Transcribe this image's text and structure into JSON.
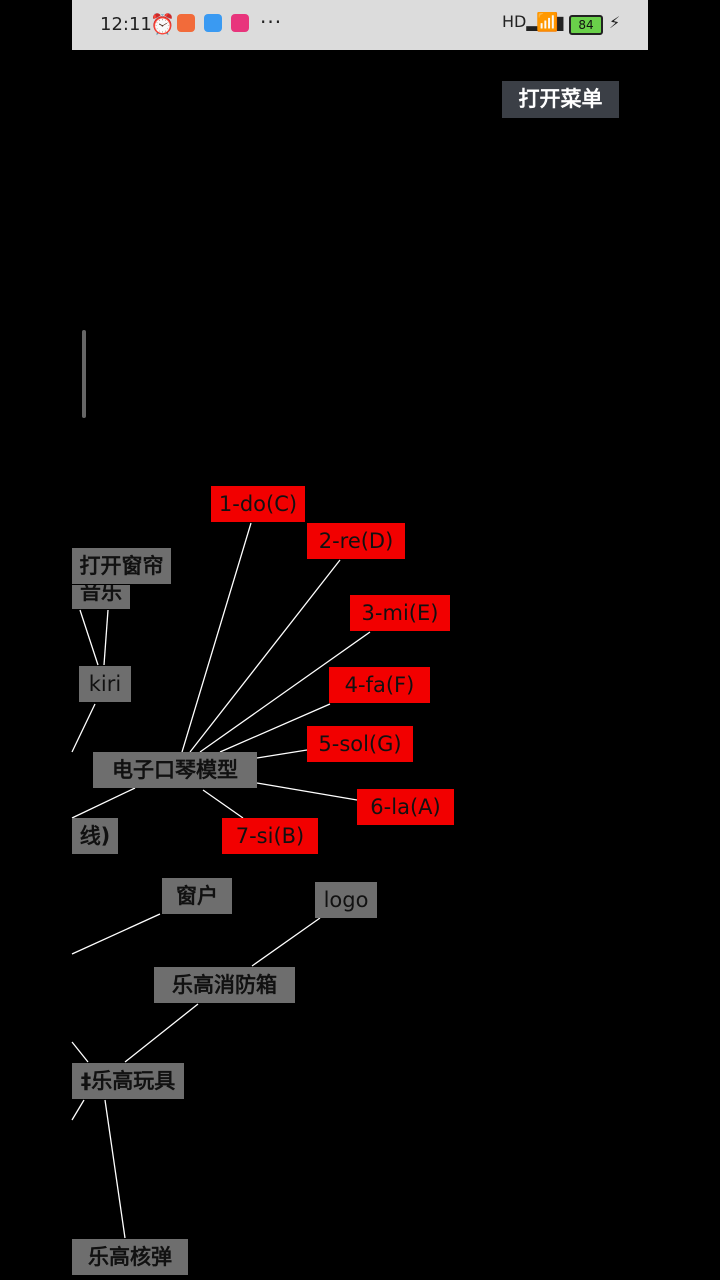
{
  "status_bar": {
    "time": "12:11",
    "battery": "84",
    "network": "HD",
    "app_icons": [
      "app-icon-1",
      "app-icon-2",
      "app-icon-3"
    ],
    "colors": {
      "icon1": "#f26b3a",
      "icon2": "#3a9af2",
      "icon3": "#e8357c"
    }
  },
  "header": {
    "menu_button": "打开菜单"
  },
  "graph": {
    "nodes": {
      "curtain": "打开窗帘",
      "music": "音乐",
      "kiri": "kiri",
      "line": "线)",
      "keyboard": "电子口琴模型",
      "do": "1-do(C)",
      "re": "2-re(D)",
      "mi": "3-mi(E)",
      "fa": "4-fa(F)",
      "sol": "5-sol(G)",
      "la": "6-la(A)",
      "si": "7-si(B)",
      "window": "窗户",
      "logo": "logo",
      "firebox": "乐高消防箱",
      "lego_toy": "‡乐高玩具",
      "nuke": "乐高核弹"
    },
    "colors": {
      "gray_node": "#6e6e6e",
      "red_node": "#f20000",
      "edge": "#ffffff"
    }
  }
}
